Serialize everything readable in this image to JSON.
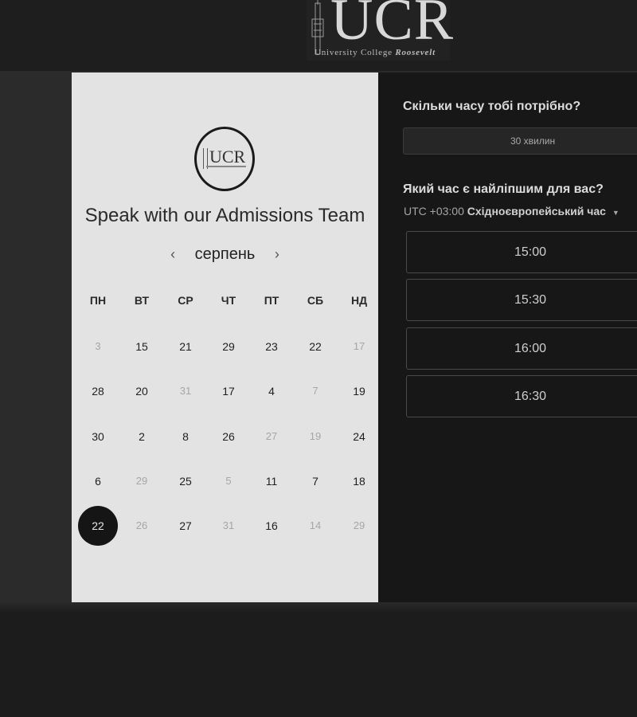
{
  "header": {
    "logo_text": "UCR",
    "logo_tagline_prefix": "University College ",
    "logo_tagline_suffix": "Roosevelt"
  },
  "calendar": {
    "small_logo_text": "UCR",
    "title": "Speak with our Admissions Team",
    "prev_icon": "‹",
    "next_icon": "›",
    "month": "серпень",
    "weekdays": [
      "ПН",
      "ВТ",
      "СР",
      "ЧТ",
      "ПТ",
      "СБ",
      "НД"
    ],
    "weeks": [
      [
        {
          "d": "3",
          "available": false
        },
        {
          "d": "15",
          "available": true
        },
        {
          "d": "21",
          "available": true
        },
        {
          "d": "29",
          "available": true
        },
        {
          "d": "23",
          "available": true
        },
        {
          "d": "22",
          "available": true
        },
        {
          "d": "17",
          "available": false
        }
      ],
      [
        {
          "d": "28",
          "available": true
        },
        {
          "d": "20",
          "available": true
        },
        {
          "d": "31",
          "available": false
        },
        {
          "d": "17",
          "available": true
        },
        {
          "d": "4",
          "available": true
        },
        {
          "d": "7",
          "available": false
        },
        {
          "d": "19",
          "available": true
        }
      ],
      [
        {
          "d": "30",
          "available": true
        },
        {
          "d": "2",
          "available": true
        },
        {
          "d": "8",
          "available": true
        },
        {
          "d": "26",
          "available": true
        },
        {
          "d": "27",
          "available": false
        },
        {
          "d": "19",
          "available": false
        },
        {
          "d": "24",
          "available": true
        }
      ],
      [
        {
          "d": "6",
          "available": true
        },
        {
          "d": "29",
          "available": false
        },
        {
          "d": "25",
          "available": true
        },
        {
          "d": "5",
          "available": false
        },
        {
          "d": "11",
          "available": true
        },
        {
          "d": "7",
          "available": true
        },
        {
          "d": "18",
          "available": true
        }
      ],
      [
        {
          "d": "22",
          "available": true,
          "selected": true
        },
        {
          "d": "26",
          "available": false
        },
        {
          "d": "27",
          "available": true
        },
        {
          "d": "31",
          "available": false
        },
        {
          "d": "16",
          "available": true
        },
        {
          "d": "14",
          "available": false
        },
        {
          "d": "29",
          "available": false
        }
      ]
    ]
  },
  "booking": {
    "duration_question": "Скільки часу тобі потрібно?",
    "duration_value": "30 хвилин",
    "time_question": "Який час є найліпшим для вас?",
    "timezone_offset": "UTC +03:00",
    "timezone_name": "Східноєвропейський час",
    "timezone_caret": "▼",
    "slots": [
      "15:00",
      "15:30",
      "16:00",
      "16:30"
    ]
  }
}
